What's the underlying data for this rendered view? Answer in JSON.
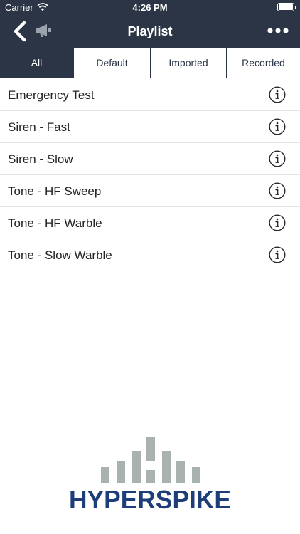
{
  "status_bar": {
    "carrier": "Carrier",
    "time": "4:26 PM",
    "battery_level": 1.0
  },
  "navbar": {
    "title": "Playlist",
    "back_icon": "chevron-left-icon",
    "horn_icon": "megaphone-icon",
    "more_icon": "ellipsis-icon"
  },
  "tabs": [
    {
      "label": "All",
      "active": true
    },
    {
      "label": "Default",
      "active": false
    },
    {
      "label": "Imported",
      "active": false
    },
    {
      "label": "Recorded",
      "active": false
    }
  ],
  "playlist": [
    {
      "label": "Emergency Test"
    },
    {
      "label": "Siren - Fast"
    },
    {
      "label": "Siren - Slow"
    },
    {
      "label": "Tone - HF Sweep"
    },
    {
      "label": "Tone - HF Warble"
    },
    {
      "label": "Tone - Slow Warble"
    }
  ],
  "logo": {
    "text": "HYPERSPIKE",
    "bar_color": "#a9b2ae",
    "text_color": "#1e3e7a"
  },
  "colors": {
    "header": "#2b3545",
    "separator": "#e3e3e3"
  }
}
